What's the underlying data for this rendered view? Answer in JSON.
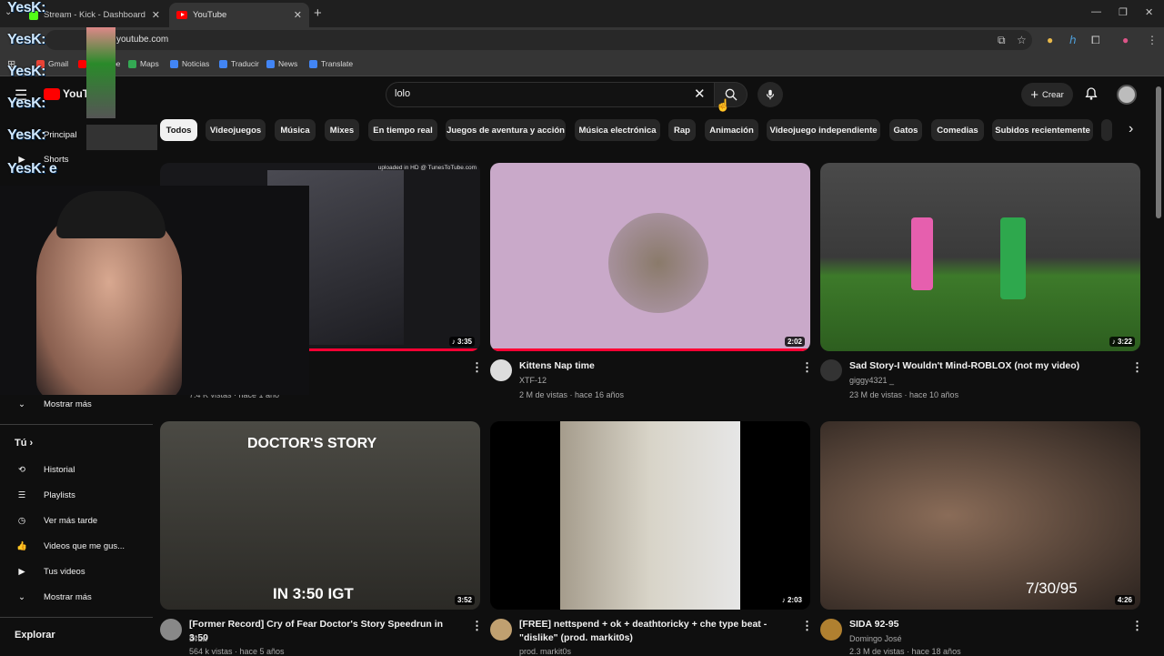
{
  "browser": {
    "tabs": [
      {
        "label": "Stream - Kick - Dashboard",
        "active": false
      },
      {
        "label": "YouTube",
        "active": true
      }
    ],
    "url": "youtube.com",
    "bookmarks": [
      "Gmail",
      "YouTube",
      "Maps",
      "Noticias",
      "Traducir",
      "News",
      "Translate"
    ]
  },
  "search": {
    "query": "lolo"
  },
  "header": {
    "create_label": "Crear",
    "logo_text": "YouTube"
  },
  "chips": [
    "Todos",
    "Videojuegos",
    "Música",
    "Mixes",
    "En tiempo real",
    "Juegos de aventura y acción",
    "Música electrónica",
    "Rap",
    "Animación",
    "Videojuego independiente",
    "Gatos",
    "Comedias",
    "Subidos recientemente"
  ],
  "sidebar": {
    "principal": "Principal",
    "shorts": "Shorts",
    "show_more_1": "Mostrar más",
    "you_header": "Tú",
    "you_items": [
      "Historial",
      "Playlists",
      "Ver más tarde",
      "Videos que me gus...",
      "Tus videos"
    ],
    "show_more_2": "Mostrar más",
    "explore_header": "Explorar"
  },
  "videos": [
    {
      "title": "",
      "channel": "",
      "meta": "7.4 K vistas · hace 1 año",
      "duration": "3:35",
      "overlay": "uploaded in HD @ TunesToTube.com",
      "thumb_color": "#2a2a2e",
      "avatar": "#555"
    },
    {
      "title": "Kittens Nap time",
      "channel": "XTF-12",
      "meta": "2 M de vistas · hace 16 años",
      "duration": "2:02",
      "thumb_color": "#c9a9c9",
      "avatar": "#ddd"
    },
    {
      "title": "Sad Story-I Wouldn't Mind-ROBLOX (not my video)",
      "channel": "giggy4321 _",
      "meta": "23 M de vistas · hace 10 años",
      "duration": "3:22",
      "thumb_color": "#3d6b2a",
      "avatar": "#333"
    },
    {
      "title": "[Former Record] Cry of Fear Doctor's Story Speedrun in 3:50",
      "channel": "DrLa",
      "meta": "564 k vistas · hace 5 años",
      "duration": "3:52",
      "overlay_top": "DOCTOR'S STORY",
      "overlay_bottom": "IN 3:50 IGT",
      "thumb_color": "#3b3a36",
      "avatar": "#888"
    },
    {
      "title": "[FREE] nettspend + ok + deathtoricky + che type beat - \"dislike\" (prod. markit0s)",
      "channel": "prod. markit0s",
      "meta": "",
      "duration": "2:03",
      "thumb_color": "#c8c8c2",
      "avatar": "#c0a070"
    },
    {
      "title": "SIDA 92-95",
      "channel": "Domingo José",
      "meta": "2.3 M de vistas · hace 18 años",
      "duration": "4:26",
      "overlay_bottom": "7/30/95",
      "thumb_color": "#5a4a3e",
      "avatar": "#b08030"
    }
  ],
  "overlay": {
    "brand": "YesK:",
    "brand_suffix": "e"
  }
}
